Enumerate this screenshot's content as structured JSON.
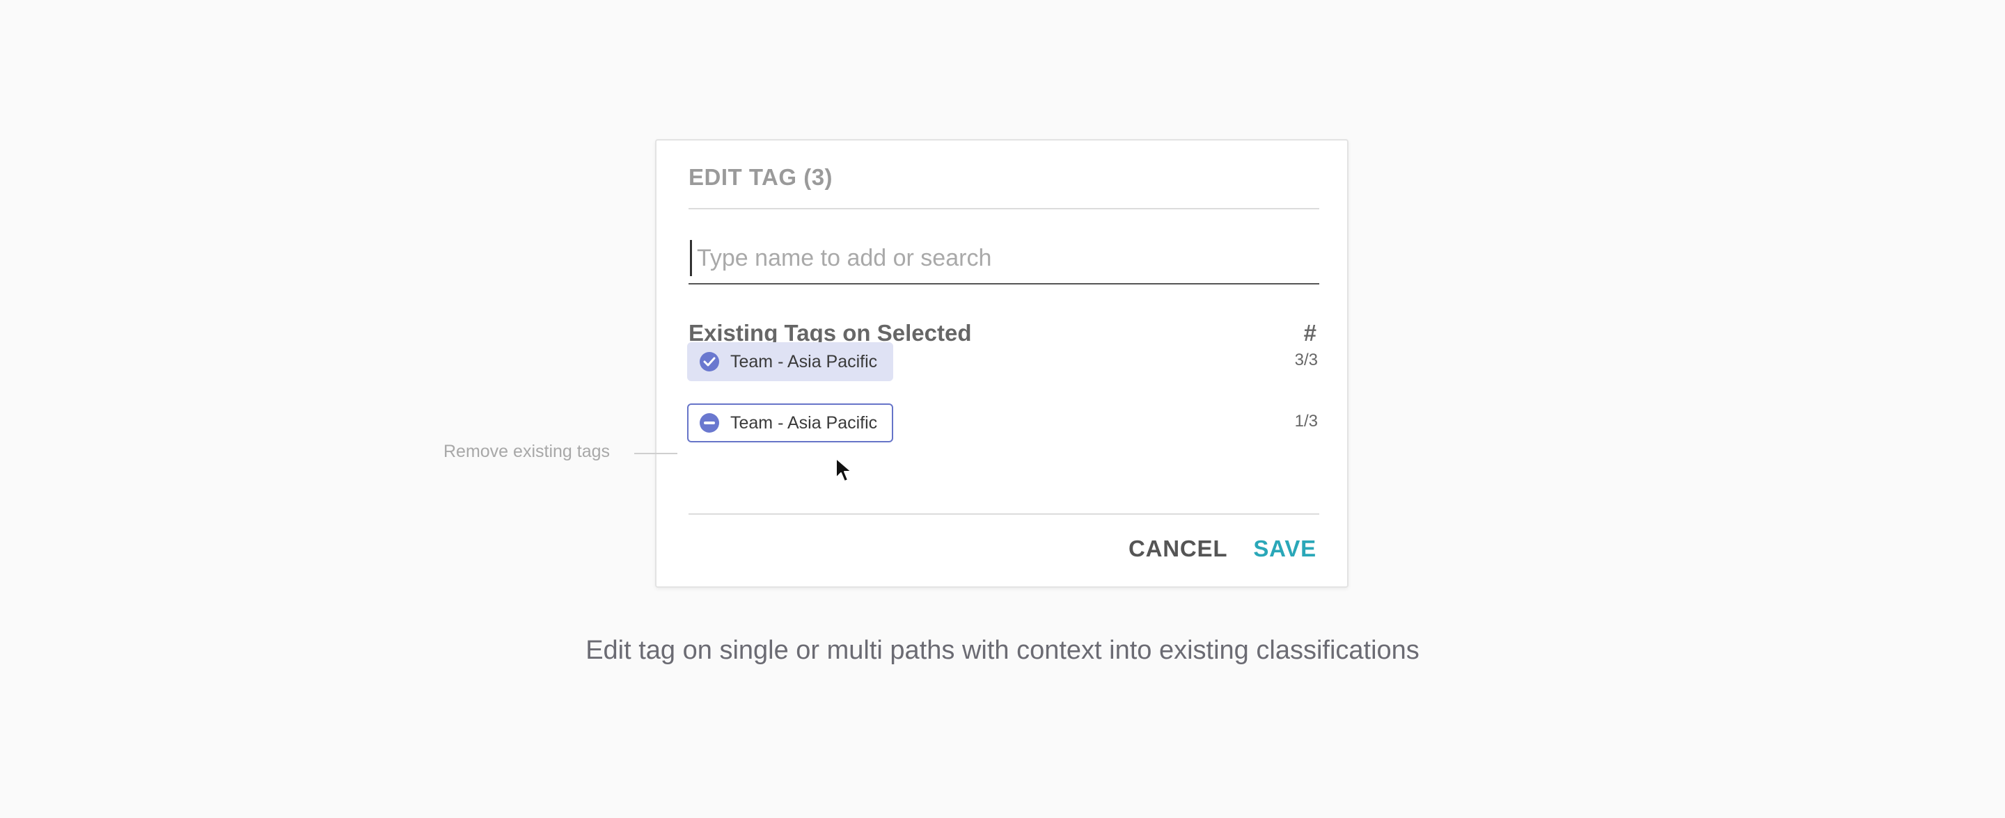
{
  "dialog": {
    "title": "EDIT TAG (3)",
    "search": {
      "placeholder": "Type name to add or search",
      "value": ""
    },
    "section_title": "Existing Tags on Selected",
    "count_header": "#",
    "tags": [
      {
        "label": "Team - Asia Pacific",
        "count": "3/3",
        "state": "applied-all",
        "icon": "check-circle-icon"
      },
      {
        "label": "Team - Asia Pacific",
        "count": "1/3",
        "state": "applied-partial",
        "icon": "minus-circle-icon"
      }
    ],
    "buttons": {
      "cancel": "CANCEL",
      "save": "SAVE"
    }
  },
  "annotation": {
    "text": "Remove existing tags"
  },
  "caption": "Edit tag on single or multi paths with context into existing classifications",
  "colors": {
    "accent": "#6a78cf",
    "chip_fill": "#dfe2f4",
    "save": "#2aa7b8",
    "background": "#fafafa"
  }
}
